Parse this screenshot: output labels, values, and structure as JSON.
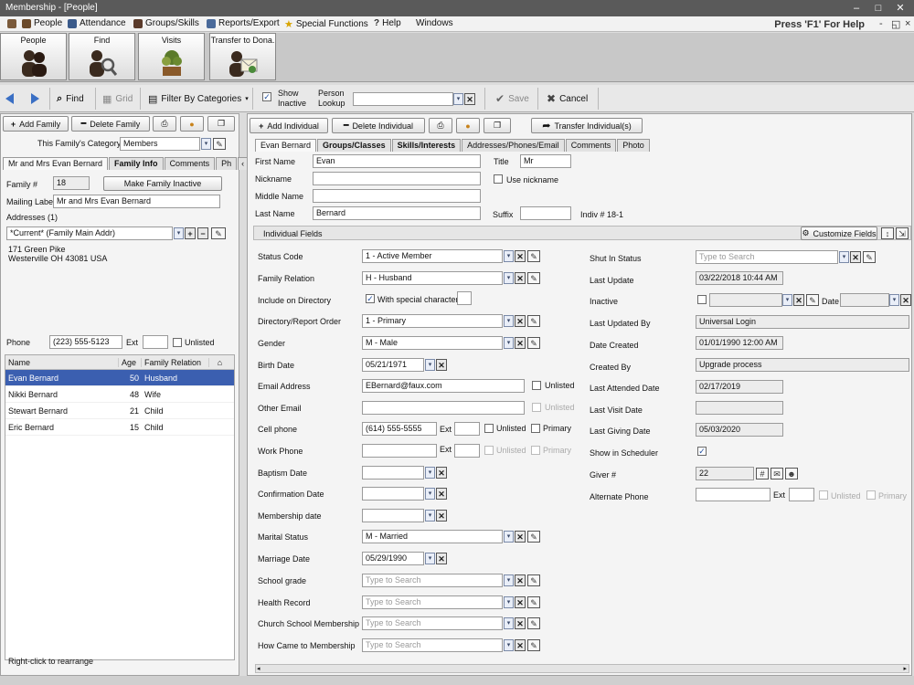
{
  "window": {
    "title": "Membership - [People]"
  },
  "menu": {
    "items": [
      "People",
      "Attendance",
      "Groups/Skills",
      "Reports/Export",
      "Special Functions",
      "Help",
      "Windows"
    ],
    "help_hint": "Press 'F1' For Help"
  },
  "nav": {
    "buttons": [
      "People",
      "Find",
      "Visits",
      "Transfer to Dona."
    ]
  },
  "toolbar": {
    "find": "Find",
    "grid": "Grid",
    "filter": "Filter By Categories",
    "show_inactive": "Show Inactive",
    "person_lookup": "Person Lookup",
    "save": "Save",
    "cancel": "Cancel"
  },
  "family": {
    "add": "Add Family",
    "delete": "Delete Family",
    "category_label": "This Family's Category:",
    "category": "Members",
    "tabs": [
      "Mr and Mrs Evan Bernard",
      "Family Info",
      "Comments",
      "Ph"
    ],
    "number_label": "Family #",
    "number": "18",
    "make_inactive": "Make Family Inactive",
    "mailing_label_label": "Mailing Label",
    "mailing_label": "Mr and Mrs Evan Bernard",
    "addresses_label": "Addresses (1)",
    "address_select": "*Current* (Family Main Addr)",
    "address_line1": "171 Green Pike",
    "address_line2": "Westerville OH  43081 USA",
    "phone_label": "Phone",
    "phone": "(223) 555-5123",
    "ext_label": "Ext",
    "unlisted": "Unlisted",
    "members_headers": [
      "Name",
      "Age",
      "Family Relation"
    ],
    "members": [
      {
        "name": "Evan Bernard",
        "age": "50",
        "relation": "Husband"
      },
      {
        "name": "Nikki Bernard",
        "age": "48",
        "relation": "Wife"
      },
      {
        "name": "Stewart Bernard",
        "age": "21",
        "relation": "Child"
      },
      {
        "name": "Eric Bernard",
        "age": "15",
        "relation": "Child"
      }
    ],
    "footer": "Right-click to rearrange"
  },
  "individual": {
    "add": "Add Individual",
    "delete": "Delete Individual",
    "transfer": "Transfer Individual(s)",
    "tabs": [
      "Evan Bernard",
      "Groups/Classes",
      "Skills/Interests",
      "Addresses/Phones/Email",
      "Comments",
      "Photo"
    ],
    "first_name_label": "First Name",
    "first_name": "Evan",
    "title_label": "Title",
    "title": "Mr",
    "nickname_label": "Nickname",
    "use_nickname": "Use nickname",
    "middle_label": "Middle Name",
    "last_label": "Last Name",
    "last_name": "Bernard",
    "suffix_label": "Suffix",
    "indiv_no": "Indiv # 18-1",
    "fields_header": "Individual Fields",
    "customize": "Customize Fields",
    "labels": {
      "status_code": "Status Code",
      "family_relation": "Family Relation",
      "include_directory": "Include on Directory",
      "dir_order": "Directory/Report Order",
      "gender": "Gender",
      "birth": "Birth Date",
      "email": "Email Address",
      "other_email": "Other Email",
      "cell": "Cell phone",
      "work": "Work Phone",
      "baptism": "Baptism Date",
      "confirmation": "Confirmation Date",
      "membership": "Membership date",
      "marital": "Marital Status",
      "marriage": "Marriage Date",
      "school_grade": "School grade",
      "health": "Health Record",
      "church_school": "Church School Membership",
      "how_came": "How Came to Membership"
    },
    "values": {
      "status_code": "1 - Active Member",
      "family_relation": "H - Husband",
      "with_special": "With special character",
      "dir_order": "1 - Primary",
      "gender": "M - Male",
      "birth": "05/21/1971",
      "email": "EBernard@faux.com",
      "cell": "(614) 555-5555",
      "marital": "M - Married",
      "marriage": "05/29/1990",
      "type_to_search": "Type to Search",
      "ext": "Ext",
      "unlisted": "Unlisted",
      "primary": "Primary"
    },
    "right_labels": {
      "shut_in": "Shut In Status",
      "last_update": "Last Update",
      "inactive": "Inactive",
      "date": "Date",
      "last_updated_by": "Last Updated By",
      "date_created": "Date Created",
      "created_by": "Created By",
      "last_attended": "Last Attended Date",
      "last_visit": "Last Visit Date",
      "last_giving": "Last Giving Date",
      "show_scheduler": "Show in Scheduler",
      "giver": "Giver #",
      "alt_phone": "Alternate Phone"
    },
    "right_values": {
      "last_update": "03/22/2018 10:44 AM",
      "last_updated_by": "Universal Login",
      "date_created": "01/01/1990 12:00 AM",
      "created_by": "Upgrade process",
      "last_attended": "02/17/2019",
      "last_giving": "05/03/2020",
      "giver": "22"
    }
  },
  "colors": {
    "selection": "#3b5fb0",
    "accent": "#3a6fc4"
  }
}
